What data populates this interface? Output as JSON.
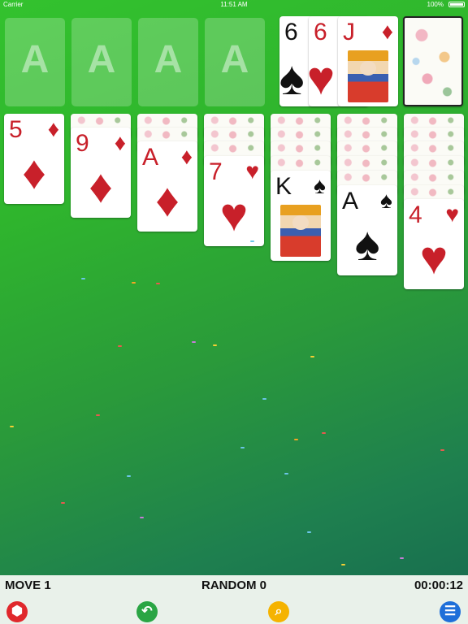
{
  "status_bar": {
    "carrier": "Carrier",
    "time": "11:51 AM",
    "battery": "100%"
  },
  "foundations": [
    "A",
    "A",
    "A",
    "A"
  ],
  "waste": [
    {
      "rank": "6",
      "suit": "♠",
      "color": "black"
    },
    {
      "rank": "6",
      "suit": "♥",
      "color": "red"
    },
    {
      "rank": "J",
      "suit": "♦",
      "color": "red"
    }
  ],
  "tableau": [
    {
      "rank": "5",
      "suit": "♦",
      "color": "red"
    },
    {
      "rank": "9",
      "suit": "♦",
      "color": "red"
    },
    {
      "rank": "A",
      "suit": "♦",
      "color": "red"
    },
    {
      "rank": "7",
      "suit": "♥",
      "color": "red"
    },
    {
      "rank": "K",
      "suit": "♠",
      "color": "black"
    },
    {
      "rank": "A",
      "suit": "♠",
      "color": "black"
    },
    {
      "rank": "4",
      "suit": "♥",
      "color": "red"
    }
  ],
  "bottom_bar": {
    "moves": "MOVE 1",
    "mode": "RANDOM 0",
    "timer": "00:00:12",
    "buttons": [
      {
        "icon": "cube-icon",
        "color": "#e0282c"
      },
      {
        "icon": "undo-icon",
        "color": "#2aa544"
      },
      {
        "icon": "search-icon",
        "color": "#f5b300"
      },
      {
        "icon": "menu-icon",
        "color": "#1e6fd9"
      }
    ]
  }
}
